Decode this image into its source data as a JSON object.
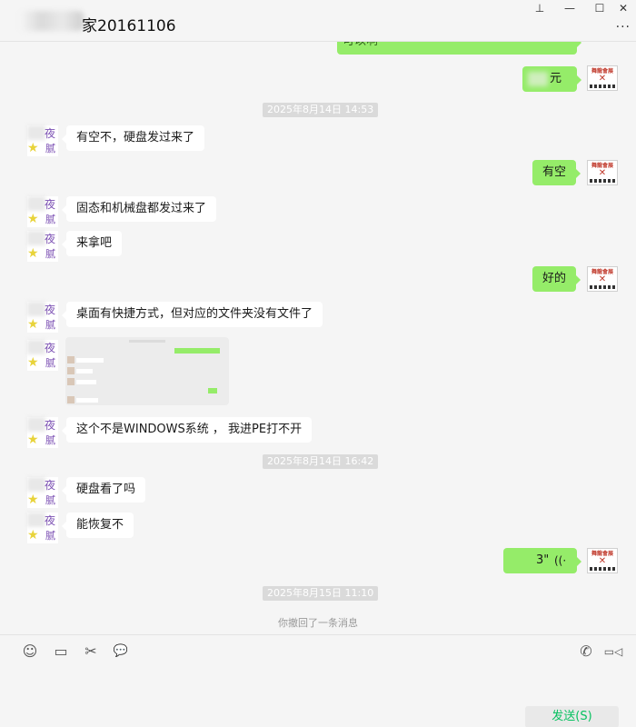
{
  "window": {
    "title": "家20161106",
    "pin_glyph": "⊥",
    "minimize_glyph": "—",
    "maximize_glyph": "☐",
    "close_glyph": "✕",
    "more_glyph": "···"
  },
  "avatars": {
    "contact_glyph_top": "夜",
    "contact_glyph_bottom": "腻",
    "contact_star": "★",
    "self_top": "舞龍會展",
    "self_x": "✕"
  },
  "messages": {
    "partial_top": "可以啊",
    "money": "元",
    "time1": "2025年8月14日 14:53",
    "m1": "有空不，硬盘发过来了",
    "m2": "有空",
    "m3": "固态和机械盘都发过来了",
    "m4": "来拿吧",
    "m5": "好的",
    "m6": "桌面有快捷方式，但对应的文件夹没有文件了",
    "m7": "这个不是WINDOWS系统 ， 我进PE打不开",
    "time2": "2025年8月14日 16:42",
    "m8": "硬盘看了吗",
    "m9": "能恢复不",
    "voice_duration": "3\"",
    "voice_icon": "((·",
    "time3": "2025年8月15日 11:10",
    "recall": "你撤回了一条消息"
  },
  "toolbar": {
    "emoji_icon": "☺",
    "folder_icon": "▭",
    "scissors_icon": "✂",
    "chat_icon": "💬",
    "phone_icon": "✆",
    "video_icon": "▭◁",
    "send_label": "发送(S)"
  },
  "colors": {
    "bubble_self": "#95ec69",
    "bubble_other": "#ffffff",
    "background": "#f5f5f5",
    "send_text": "#07c160"
  }
}
